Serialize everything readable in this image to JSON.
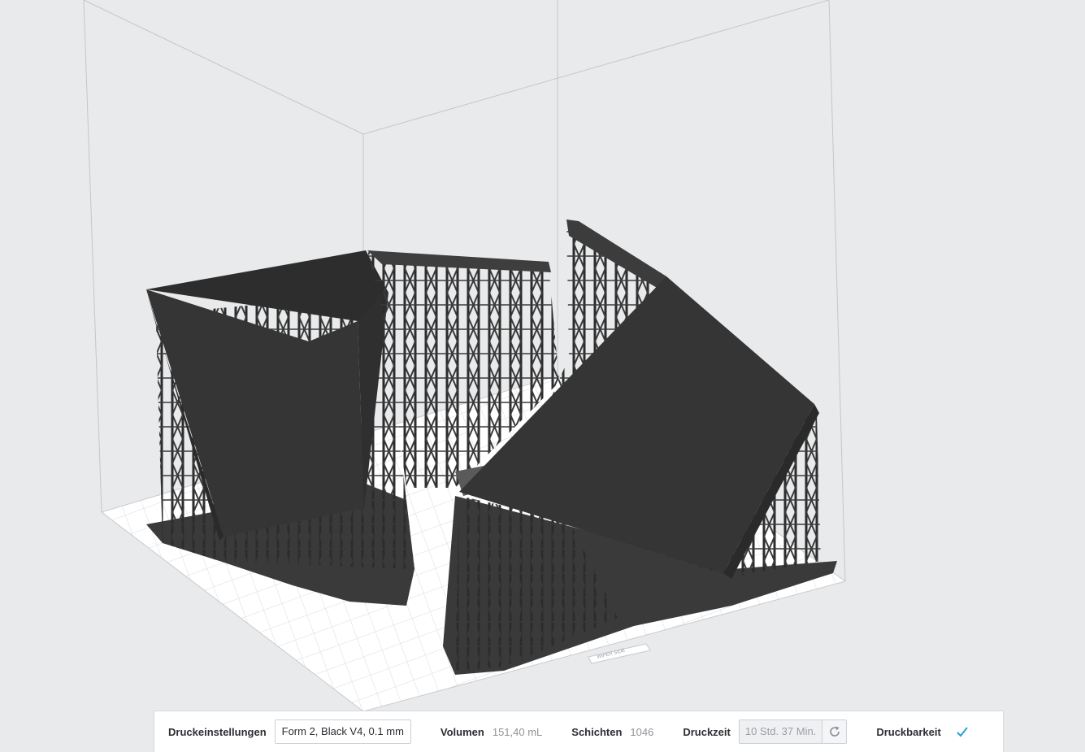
{
  "viewport": {
    "plate_label": "WIPER SIDE"
  },
  "status_bar": {
    "print_settings_label": "Druckeinstellungen",
    "print_settings_value": "Form 2, Black V4, 0.1 mm",
    "volume_label": "Volumen",
    "volume_value": "151,40 mL",
    "layers_label": "Schichten",
    "layers_value": "1046",
    "print_time_label": "Druckzeit",
    "print_time_value": "10 Std. 37 Min.",
    "printability_label": "Druckbarkeit",
    "icons": {
      "refresh": "refresh-icon",
      "printability_status": "checkmark-icon"
    },
    "colors": {
      "check": "#2a9fd8",
      "model": "#353535"
    }
  }
}
